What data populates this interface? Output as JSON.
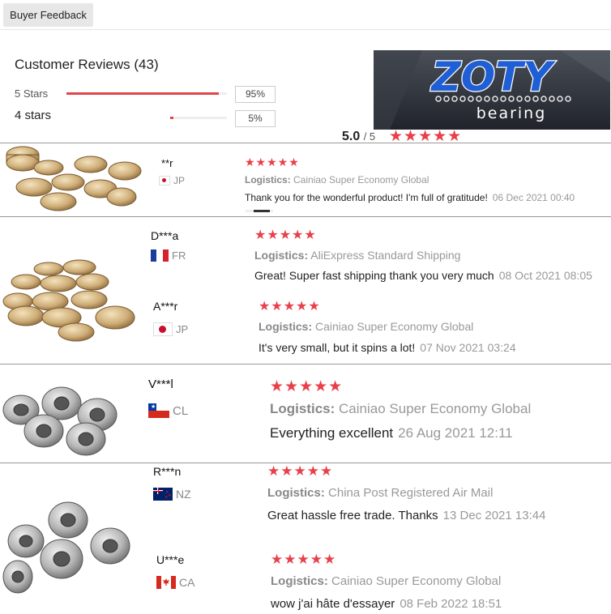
{
  "tab_label": "Buyer Feedback",
  "reviews_title": "Customer Reviews (43)",
  "rating_rows": [
    {
      "label": "5 Stars",
      "percent_text": "95%",
      "fill": 0.95
    },
    {
      "label": "4 stars",
      "percent_text": "5%",
      "fill": 0.05
    }
  ],
  "average": {
    "score": "5.0",
    "out_of": "/ 5",
    "stars": "★★★★★"
  },
  "logo": {
    "brand": "ZOTY",
    "subtitle": "bearing"
  },
  "colors": {
    "star": "#e8404a",
    "bar": "#e0464a"
  },
  "reviews": [
    {
      "user": "**r",
      "country": "JP",
      "stars": "★★★★★",
      "logistics_label": "Logistics:",
      "logistics": "Cainiao Super Economy Global",
      "text": "Thank you for the wonderful product! I'm full of gratitude!",
      "date": "06 Dec 2021 00:40"
    },
    {
      "user": "D***a",
      "country": "FR",
      "stars": "★★★★★",
      "logistics_label": "Logistics:",
      "logistics": "AliExpress Standard Shipping",
      "text": "Great! Super fast shipping thank you very much",
      "date": "08 Oct 2021 08:05"
    },
    {
      "user": "A***r",
      "country": "JP",
      "stars": "★★★★★",
      "logistics_label": "Logistics:",
      "logistics": "Cainiao Super Economy Global",
      "text": "It's very small, but it spins a lot!",
      "date": "07 Nov 2021 03:24"
    },
    {
      "user": "V***l",
      "country": "CL",
      "stars": "★★★★★",
      "logistics_label": "Logistics:",
      "logistics": "Cainiao Super Economy Global",
      "text": "Everything excellent",
      "date": "26 Aug 2021 12:11"
    },
    {
      "user": "R***n",
      "country": "NZ",
      "stars": "★★★★★",
      "logistics_label": "Logistics:",
      "logistics": "China Post Registered Air Mail",
      "text": "Great hassle free trade. Thanks",
      "date": "13 Dec 2021 13:44"
    },
    {
      "user": "U***e",
      "country": "CA",
      "stars": "★★★★★",
      "logistics_label": "Logistics:",
      "logistics": "Cainiao Super Economy Global",
      "text": "wow j'ai hâte d'essayer",
      "date": "08 Feb 2022 18:51"
    }
  ]
}
